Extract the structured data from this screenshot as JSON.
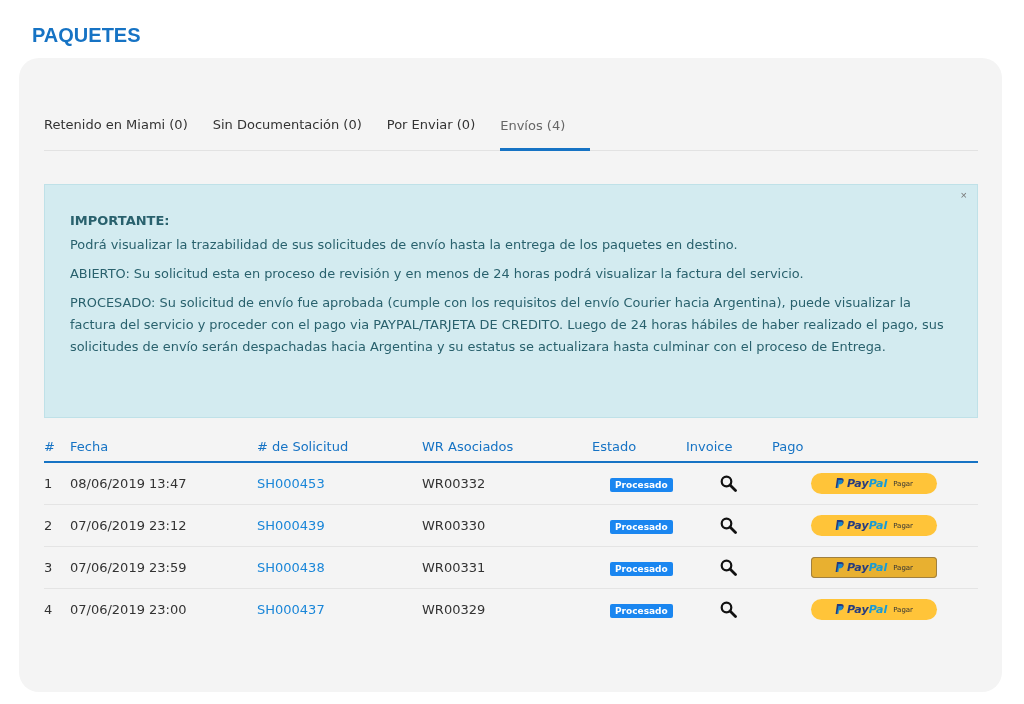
{
  "page_title": "PAQUETES",
  "tabs": [
    {
      "label": "Retenido en Miami (0)",
      "selected": false
    },
    {
      "label": "Sin Documentación (0)",
      "selected": false
    },
    {
      "label": "Por Enviar (0)",
      "selected": false
    },
    {
      "label": "Envíos (4)",
      "selected": true
    }
  ],
  "alert": {
    "close": "×",
    "heading": "IMPORTANTE:",
    "paragraphs": [
      "Podrá visualizar la trazabilidad de sus solicitudes de envío hasta la entrega de los paquetes en destino.",
      "ABIERTO: Su solicitud esta en proceso de revisión y en menos de 24 horas podrá visualizar la factura del servicio.",
      "PROCESADO: Su solicitud de envío fue aprobada (cumple con los requisitos del envío Courier hacia Argentina), puede visualizar la factura del servicio y proceder con el pago via PAYPAL/TARJETA DE CREDITO. Luego de 24 horas hábiles de haber realizado el pago, sus solicitudes de envío serán despachadas hacia Argentina y su estatus se actualizara hasta culminar con el proceso de Entrega."
    ]
  },
  "table": {
    "columns": [
      "#",
      "Fecha",
      "# de Solicitud",
      "WR Asociados",
      "Estado",
      "Invoice",
      "Pago"
    ],
    "rows": [
      {
        "index": "1",
        "date": "08/06/2019 13:47",
        "request": "SH000453",
        "wr": "WR00332",
        "status": "Procesado",
        "pay": {
          "brand_a": "Pay",
          "brand_b": "Pal",
          "label": "Pagar",
          "hovered": false
        }
      },
      {
        "index": "2",
        "date": "07/06/2019 23:12",
        "request": "SH000439",
        "wr": "WR00330",
        "status": "Procesado",
        "pay": {
          "brand_a": "Pay",
          "brand_b": "Pal",
          "label": "Pagar",
          "hovered": false
        }
      },
      {
        "index": "3",
        "date": "07/06/2019 23:59",
        "request": "SH000438",
        "wr": "WR00331",
        "status": "Procesado",
        "pay": {
          "brand_a": "Pay",
          "brand_b": "Pal",
          "label": "Pagar",
          "hovered": true
        }
      },
      {
        "index": "4",
        "date": "07/06/2019 23:00",
        "request": "SH000437",
        "wr": "WR00329",
        "status": "Procesado",
        "pay": {
          "brand_a": "Pay",
          "brand_b": "Pal",
          "label": "Pagar",
          "hovered": false
        }
      }
    ]
  }
}
